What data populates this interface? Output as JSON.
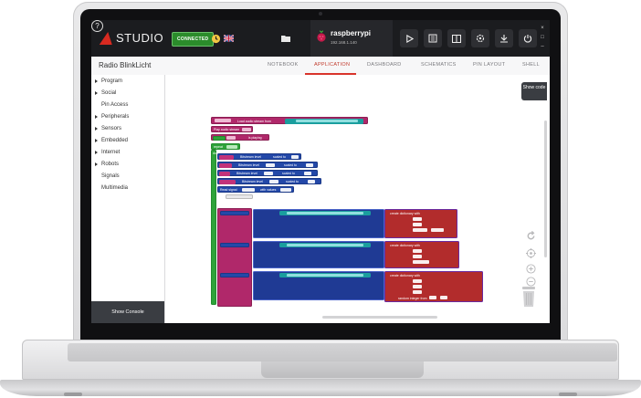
{
  "app": {
    "logo_text": "STUDIO",
    "connection_status": "CONNECTED",
    "device": {
      "name": "raspberrypi",
      "ip": "192.168.1.140"
    },
    "toolbar_icons": [
      "clock-icon",
      "flag-icon",
      "help-icon",
      "folder-icon",
      "play-icon",
      "firmware-icon",
      "book-icon",
      "settings-icon",
      "deploy-icon",
      "power-icon"
    ]
  },
  "project": {
    "title": "Radio BlinkLicht"
  },
  "tabs": [
    {
      "label": "NOTEBOOK",
      "active": false
    },
    {
      "label": "APPLICATION",
      "active": true
    },
    {
      "label": "DASHBOARD",
      "active": false
    },
    {
      "label": "SCHEMATICS",
      "active": false
    },
    {
      "label": "PIN LAYOUT",
      "active": false
    },
    {
      "label": "SHELL",
      "active": false
    }
  ],
  "sidebar": {
    "categories": [
      {
        "label": "Program",
        "expandable": true
      },
      {
        "label": "Social",
        "expandable": true
      },
      {
        "label": "Pin Access",
        "expandable": false
      },
      {
        "label": "Peripherals",
        "expandable": true
      },
      {
        "label": "Sensors",
        "expandable": true
      },
      {
        "label": "Embedded",
        "expandable": true
      },
      {
        "label": "Internet",
        "expandable": true
      },
      {
        "label": "Robots",
        "expandable": true
      },
      {
        "label": "Signals",
        "expandable": false
      },
      {
        "label": "Multimedia",
        "expandable": false
      }
    ],
    "console_button": "Show Console"
  },
  "workspace": {
    "show_code_label": "Show code",
    "tools": [
      "undo-icon",
      "center-icon",
      "zoom-in-icon",
      "zoom-out-icon",
      "trash-icon"
    ],
    "blocks": {
      "load_audio": "Load audio stream from",
      "play_audio": "Play audio stream",
      "audio_playing": "is playing",
      "repeat": "repeat",
      "do": "do",
      "bitstream_level": "Bitstream level",
      "scaled_to": "scaled to",
      "read_signal": "Read signal",
      "with_values": "with values",
      "create_dictionary": "create dictionary with",
      "random_integer": "random integer from"
    },
    "colors": {
      "pink": "#b0286a",
      "green": "#2ea33a",
      "blue": "#2348a8",
      "purple": "#7a1e7a",
      "red": "#b22c2c",
      "teal": "#1a9e9e"
    }
  }
}
